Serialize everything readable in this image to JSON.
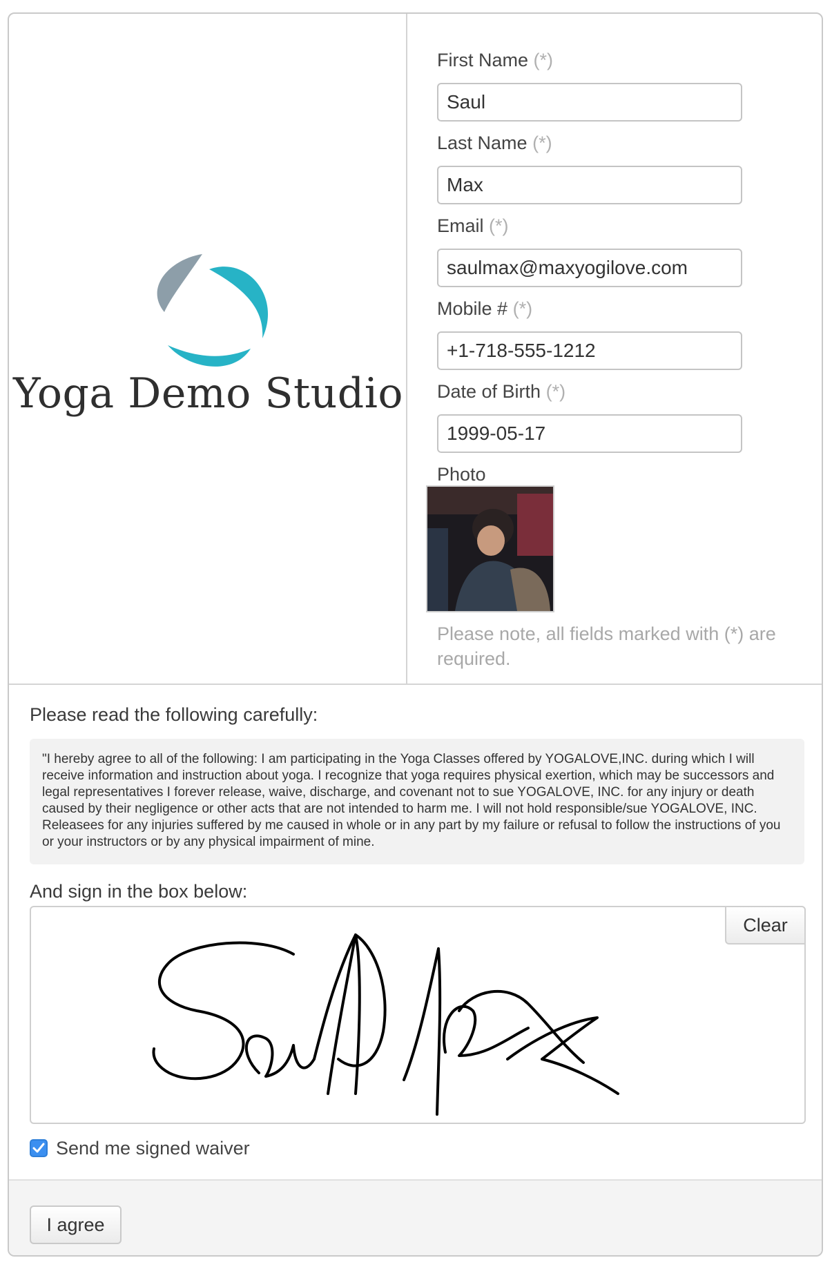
{
  "brand": {
    "studio_name": "Yoga Demo Studio",
    "logo_icon": "swirl-logo-icon",
    "colors": {
      "logo_gray": "#8d9ea9",
      "logo_teal": "#27b3c6"
    }
  },
  "form": {
    "first_name": {
      "label": "First Name",
      "required_marker": "(*)",
      "value": "Saul"
    },
    "last_name": {
      "label": "Last Name",
      "required_marker": "(*)",
      "value": "Max"
    },
    "email": {
      "label": "Email",
      "required_marker": "(*)",
      "value": "saulmax@maxyogilove.com"
    },
    "mobile": {
      "label": "Mobile #",
      "required_marker": "(*)",
      "value": "+1-718-555-1212"
    },
    "dob": {
      "label": "Date of Birth",
      "required_marker": "(*)",
      "value": "1999-05-17"
    },
    "photo": {
      "label": "Photo"
    },
    "note": "Please note, all fields marked with (*) are required."
  },
  "waiver": {
    "read_label": "Please read the following carefully:",
    "text": "\"I hereby agree to all of the following: I am participating in the Yoga Classes offered by YOGALOVE,INC. during which I will receive information and instruction about yoga. I recognize that yoga requires physical exertion, which may be successors and legal representatives I forever release, waive, discharge, and covenant not to sue YOGALOVE, INC. for any injury or death caused by their negligence or other acts that are not intended to harm me. I will not hold responsible/sue YOGALOVE, INC. Releasees for any injuries suffered by me caused in whole or in any part by my failure or refusal to follow the instructions of you or your instructors or by any physical impairment of mine.",
    "sign_label": "And sign in the box below:",
    "clear_label": "Clear",
    "send_copy_label": "Send me signed waiver",
    "send_copy_checked": true,
    "agree_label": "I agree",
    "accent_color": "#3b8ff0"
  }
}
